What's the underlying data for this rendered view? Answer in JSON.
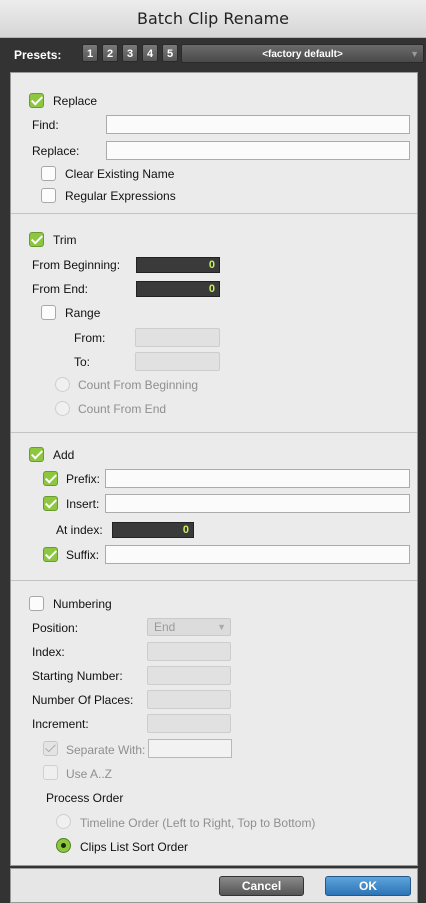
{
  "window": {
    "title": "Batch Clip Rename"
  },
  "presets": {
    "label": "Presets:",
    "buttons": [
      "1",
      "2",
      "3",
      "4",
      "5"
    ],
    "current": "<factory default>"
  },
  "replace": {
    "label": "Replace",
    "checked": true,
    "find_label": "Find:",
    "find_value": "",
    "replace_label": "Replace:",
    "replace_value": "",
    "clear_existing_label": "Clear Existing Name",
    "regex_label": "Regular Expressions"
  },
  "trim": {
    "label": "Trim",
    "checked": true,
    "from_beginning_label": "From Beginning:",
    "from_beginning_value": "0",
    "from_end_label": "From End:",
    "from_end_value": "0",
    "range_label": "Range",
    "from_label": "From:",
    "to_label": "To:",
    "count_from_beginning_label": "Count From Beginning",
    "count_from_end_label": "Count From End"
  },
  "add": {
    "label": "Add",
    "checked": true,
    "prefix_label": "Prefix:",
    "insert_label": "Insert:",
    "at_index_label": "At index:",
    "at_index_value": "0",
    "suffix_label": "Suffix:"
  },
  "numbering": {
    "label": "Numbering",
    "checked": false,
    "position_label": "Position:",
    "position_value": "End",
    "index_label": "Index:",
    "starting_number_label": "Starting Number:",
    "number_of_places_label": "Number Of Places:",
    "increment_label": "Increment:",
    "separate_with_label": "Separate With:",
    "use_az_label": "Use A..Z",
    "process_order_label": "Process Order",
    "timeline_order_label": "Timeline Order (Left to Right, Top to Bottom)",
    "clips_list_label": "Clips List Sort Order",
    "selected_order": "Clips List Sort Order"
  },
  "footer": {
    "cancel_label": "Cancel",
    "ok_label": "OK"
  },
  "colors": {
    "accent_green": "#8dc63f",
    "ok_blue": "#2c74b6",
    "numeric_text": "#c8f05a"
  }
}
